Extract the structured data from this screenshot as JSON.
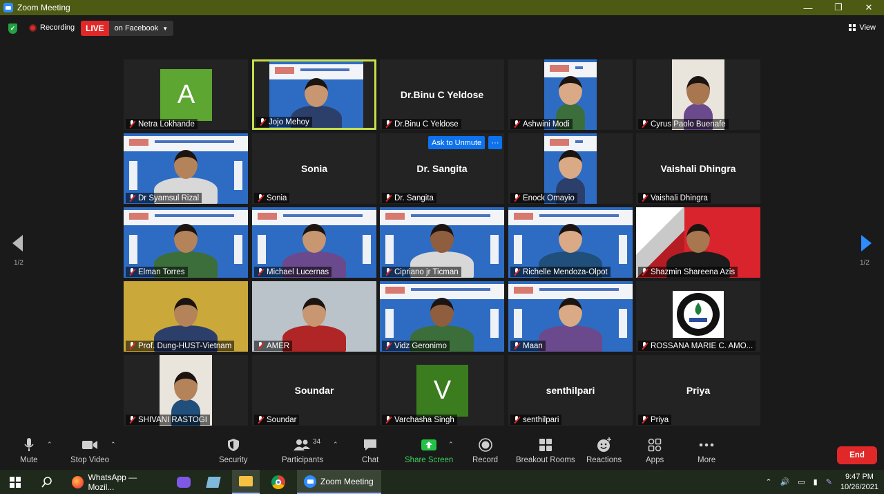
{
  "window": {
    "title": "Zoom Meeting"
  },
  "topbar": {
    "recording_label": "Recording",
    "live_label": "LIVE",
    "live_destination": "on Facebook",
    "view_label": "View"
  },
  "gallery": {
    "page_indicator_left": "1/2",
    "page_indicator_right": "1/2",
    "ask_to_unmute": "Ask to Unmute",
    "more_options": "···",
    "tiles": [
      {
        "name": "Netra Lokhande",
        "kind": "avatar",
        "letter": "A",
        "bg": "#5ea632"
      },
      {
        "name": "Jojo Mehoy",
        "kind": "video",
        "active": true
      },
      {
        "name": "Dr.Binu C Yeldose",
        "kind": "name"
      },
      {
        "name": "Ashwini Modi",
        "kind": "video"
      },
      {
        "name": "Cyrus Paolo Buenafe",
        "kind": "video"
      },
      {
        "name": "Dr Syamsul Rizal",
        "kind": "video"
      },
      {
        "name": "Sonia",
        "kind": "name"
      },
      {
        "name": "Dr. Sangita",
        "kind": "name"
      },
      {
        "name": "Enock Omayio",
        "kind": "video"
      },
      {
        "name": "Vaishali Dhingra",
        "kind": "name"
      },
      {
        "name": "Elman Torres",
        "kind": "video"
      },
      {
        "name": "Michael Lucernas",
        "kind": "video"
      },
      {
        "name": "Cipriano jr Ticman",
        "kind": "video"
      },
      {
        "name": "Richelle Mendoza-Olpot",
        "kind": "video"
      },
      {
        "name": "Shazmin Shareena Azis",
        "kind": "video"
      },
      {
        "name": "Prof. Dung-HUST-Vietnam",
        "kind": "video"
      },
      {
        "name": "AMER",
        "kind": "video"
      },
      {
        "name": "Vidz Geronimo",
        "kind": "video"
      },
      {
        "name": "Maan",
        "kind": "video"
      },
      {
        "name": "ROSSANA MARIE C. AMO...",
        "kind": "logo"
      },
      {
        "name": "SHIVANI RASTOGI",
        "kind": "video"
      },
      {
        "name": "Soundar",
        "kind": "name"
      },
      {
        "name": "Varchasha Singh",
        "kind": "avatar",
        "letter": "V",
        "bg": "#3b7d1e"
      },
      {
        "name": "senthilpari",
        "kind": "name"
      },
      {
        "name": "Priya",
        "kind": "name"
      }
    ]
  },
  "toolbar": {
    "mute": "Mute",
    "stop_video": "Stop Video",
    "security": "Security",
    "participants": "Participants",
    "participants_count": "34",
    "chat": "Chat",
    "share_screen": "Share Screen",
    "record": "Record",
    "breakout_rooms": "Breakout Rooms",
    "reactions": "Reactions",
    "apps": "Apps",
    "more": "More",
    "end": "End"
  },
  "taskbar": {
    "whatsapp": "WhatsApp — Mozil...",
    "zoom": "Zoom Meeting",
    "time": "9:47 PM",
    "date": "10/26/2021"
  },
  "colors": {
    "accent": "#2d8cff",
    "end": "#e02828",
    "active_border": "#c7df4a",
    "titlebar": "#4d5a13"
  }
}
